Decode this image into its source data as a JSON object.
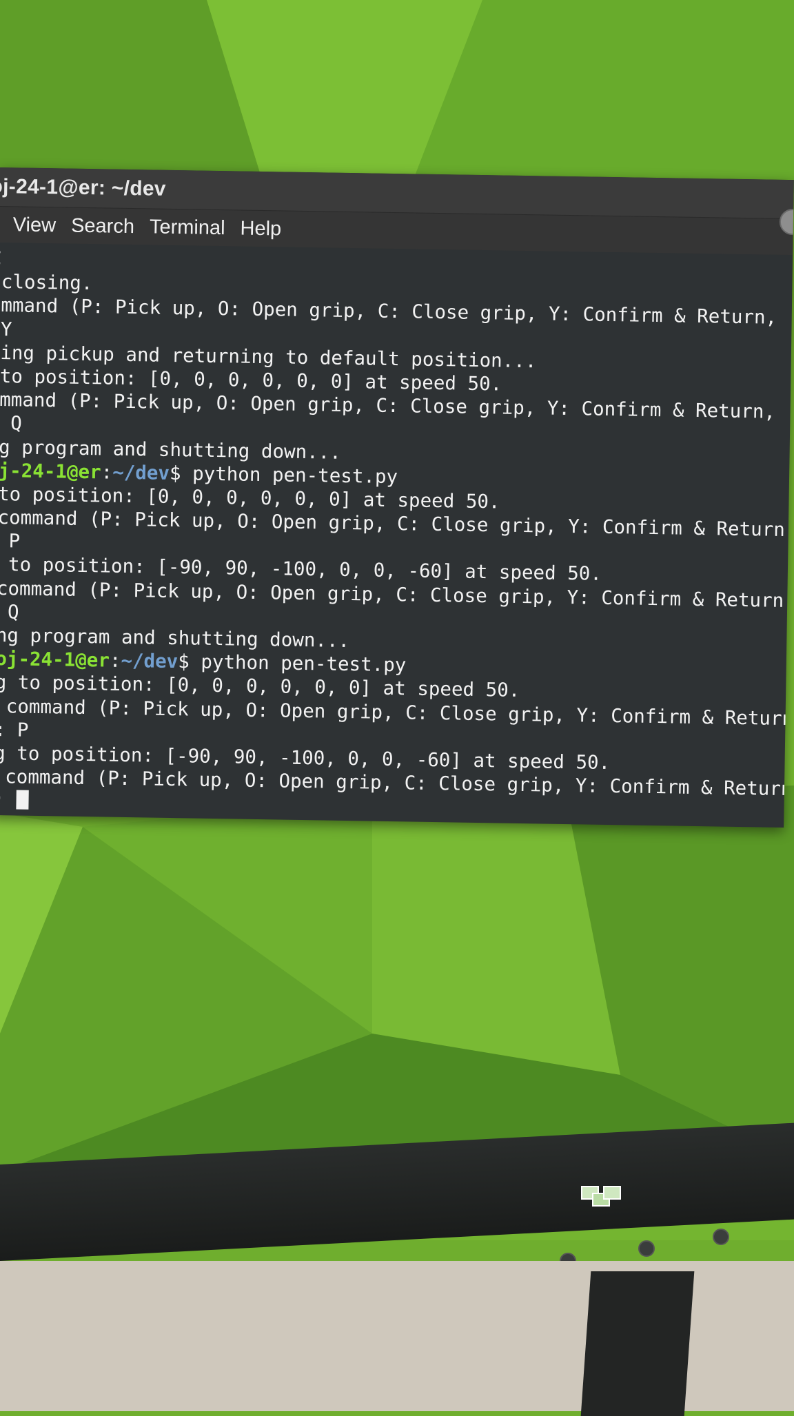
{
  "window": {
    "title": "oj-24-1@er: ~/dev"
  },
  "menu": {
    "items": [
      "t",
      "View",
      "Search",
      "Terminal",
      "Help"
    ]
  },
  "terminal": {
    "lines": [
      {
        "text": "C"
      },
      {
        "text": " closing."
      },
      {
        "text": "ommand (P: Pick up, O: Open grip, C: Close grip, Y: Confirm & Return,"
      },
      {
        "text": " Y"
      },
      {
        "text": "ning pickup and returning to default position..."
      },
      {
        "text": " to position: [0, 0, 0, 0, 0, 0] at speed 50."
      },
      {
        "text": "ommand (P: Pick up, O: Open grip, C: Close grip, Y: Confirm & Return,"
      },
      {
        "text": "  Q"
      },
      {
        "text": "ng program and shutting down..."
      },
      {
        "user": "oj-24-1@er",
        "path": "~/dev",
        "text": "$ python pen-test.py"
      },
      {
        "text": " to position: [0, 0, 0, 0, 0, 0] at speed 50."
      },
      {
        "text": " command (P: Pick up, O: Open grip, C: Close grip, Y: Confirm & Return,"
      },
      {
        "text": ": P"
      },
      {
        "text": "g to position: [-90, 90, -100, 0, 0, -60] at speed 50."
      },
      {
        "text": " command (P: Pick up, O: Open grip, C: Close grip, Y: Confirm & Return, ("
      },
      {
        "text": ": Q"
      },
      {
        "text": "ing program and shutting down..."
      },
      {
        "user": "roj-24-1@er",
        "path": "~/dev",
        "text": "$ python pen-test.py"
      },
      {
        "text": "ng to position: [0, 0, 0, 0, 0, 0] at speed 50."
      },
      {
        "text": "r command (P: Pick up, O: Open grip, C: Close grip, Y: Confirm & Return, Q"
      },
      {
        "text": "): P"
      },
      {
        "text": "ng to position: [-90, 90, -100, 0, 0, -60] at speed 50."
      },
      {
        "text": "r command (P: Pick up, O: Open grip, C: Close grip, Y: Confirm & Return, Q"
      },
      {
        "text": "): ",
        "cursor": true
      }
    ]
  },
  "colors": {
    "prompt_user": "#8ae234",
    "prompt_path": "#729fcf",
    "terminal_bg": "#2e3234",
    "wallpaper": "#6fae2e"
  }
}
